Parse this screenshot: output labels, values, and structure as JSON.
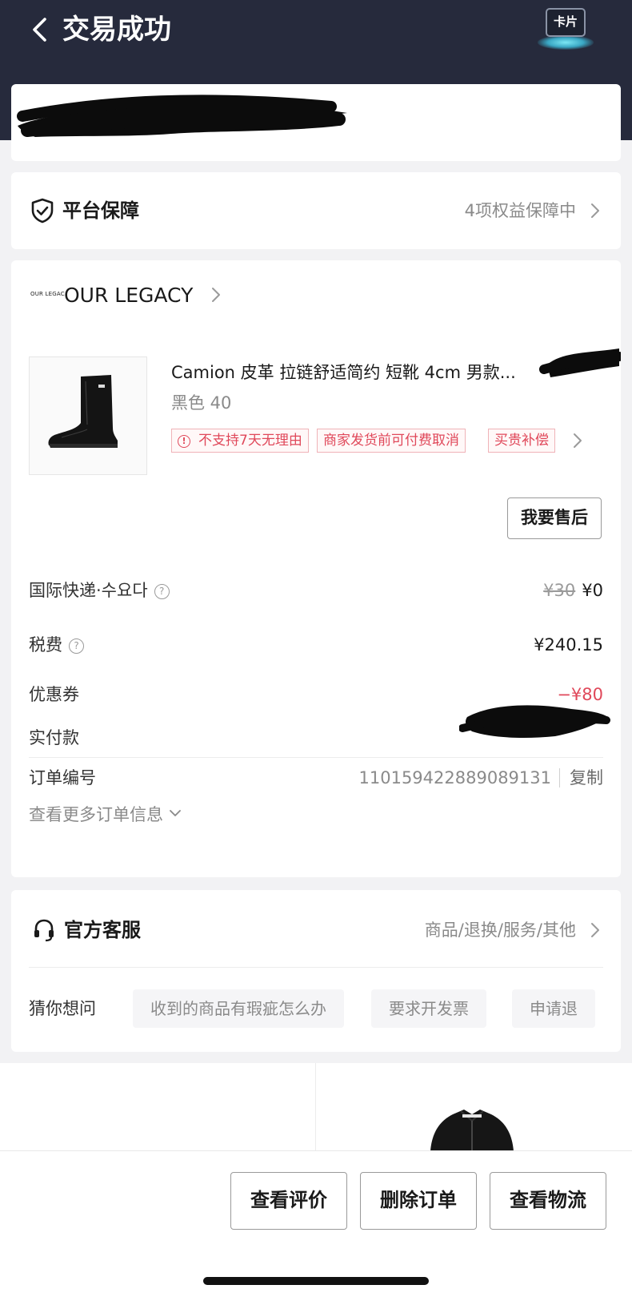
{
  "header": {
    "title": "交易成功",
    "card_button_label": "卡片"
  },
  "guarantee": {
    "label": "平台保障",
    "value": "4项权益保障中"
  },
  "order": {
    "brand_logo_text": "OUR LEGAC",
    "brand_name": "OUR LEGACY",
    "product_title": "Camion 皮革 拉链舒适简约 短靴 4cm 男款...",
    "product_variant": "黑色 40",
    "tags": [
      "不支持7天无理由",
      "商家发货前可付费取消",
      "买贵补偿"
    ],
    "after_sales_button": "我要售后",
    "shipping_label": "国际快递·수요다",
    "shipping_original_price": "¥30",
    "shipping_price": "¥0",
    "tax_label": "税费",
    "tax_value": "¥240.15",
    "coupon_label": "优惠券",
    "coupon_value": "−¥80",
    "paid_label": "实付款",
    "order_no_label": "订单编号",
    "order_no": "1101594228890891​31",
    "copy_label": "复制",
    "more_info_label": "查看更多订单信息"
  },
  "service": {
    "label": "官方客服",
    "value": "商品/退换/服务/其他",
    "guess_label": "猜你想问",
    "questions": [
      "收到的商品有瑕疵怎么办",
      "要求开发票",
      "申请退"
    ]
  },
  "actions": {
    "review_label": "查看评价",
    "delete_label": "删除订单",
    "logistics_label": "查看物流"
  },
  "colors": {
    "header_bg": "#262a3c",
    "accent_red": "#e0485a",
    "page_bg": "#f2f2f4"
  }
}
